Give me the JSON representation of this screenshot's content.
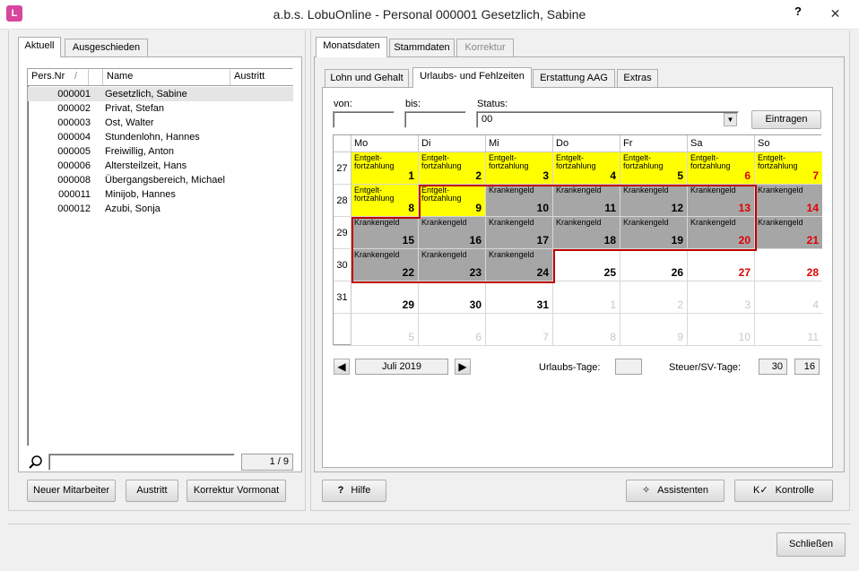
{
  "window": {
    "title": "a.b.s. LobuOnline - Personal 000001 Gesetzlich, Sabine",
    "help": "?",
    "close": "✕",
    "icon": "app-logo-icon"
  },
  "left_tabs": [
    "Aktuell",
    "Ausgeschieden"
  ],
  "list": {
    "columns": [
      "Pers.Nr",
      "Name",
      "Austritt"
    ],
    "sort_indicator": "/",
    "rows": [
      {
        "nr": "000001",
        "name": "Gesetzlich, Sabine"
      },
      {
        "nr": "000002",
        "name": "Privat, Stefan"
      },
      {
        "nr": "000003",
        "name": "Ost, Walter"
      },
      {
        "nr": "000004",
        "name": "Stundenlohn, Hannes"
      },
      {
        "nr": "000005",
        "name": "Freiwillig, Anton"
      },
      {
        "nr": "000006",
        "name": "Altersteilzeit, Hans"
      },
      {
        "nr": "000008",
        "name": "Übergangsbereich, Michael"
      },
      {
        "nr": "000011",
        "name": "Minijob, Hannes"
      },
      {
        "nr": "000012",
        "name": "Azubi, Sonja"
      }
    ],
    "search_value": "",
    "counter": "1 / 9"
  },
  "left_buttons": {
    "new_employee": "Neuer Mitarbeiter",
    "exit": "Austritt",
    "correction": "Korrektur Vormonat"
  },
  "top_tabs": [
    "Monatsdaten",
    "Stammdaten",
    "Korrektur"
  ],
  "sub_tabs": [
    "Lohn und Gehalt",
    "Urlaubs- und Fehlzeiten",
    "Erstattung AAG",
    "Extras"
  ],
  "form": {
    "from_label": "von:",
    "from_value": "",
    "to_label": "bis:",
    "to_value": "",
    "status_label": "Status:",
    "status_value": "00",
    "enter_button": "Eintragen"
  },
  "calendar": {
    "days": [
      "Mo",
      "Di",
      "Mi",
      "Do",
      "Fr",
      "Sa",
      "So"
    ],
    "weeks": [
      "27",
      "28",
      "29",
      "30",
      "31",
      ""
    ],
    "cells": [
      [
        "1",
        "2",
        "3",
        "4",
        "5",
        "6",
        "7"
      ],
      [
        "8",
        "9",
        "10",
        "11",
        "12",
        "13",
        "14"
      ],
      [
        "15",
        "16",
        "17",
        "18",
        "19",
        "20",
        "21"
      ],
      [
        "22",
        "23",
        "24",
        "25",
        "26",
        "27",
        "28"
      ],
      [
        "29",
        "30",
        "31",
        "1",
        "2",
        "3",
        "4"
      ],
      [
        "5",
        "6",
        "7",
        "8",
        "9",
        "10",
        "11"
      ]
    ],
    "label_entgelt_1": "Entgelt-",
    "label_entgelt_2": "fortzahlung",
    "label_krank": "Krankengeld"
  },
  "nav": {
    "prev": "◀",
    "month": "Juli 2019",
    "next": "▶"
  },
  "stats": {
    "vacation_label": "Urlaubs-Tage:",
    "vacation_value": "",
    "tax_label": "Steuer/SV-Tage:",
    "tax_value1": "30",
    "tax_value2": "16"
  },
  "bottom_buttons": {
    "help": "Hilfe",
    "assistant": "Assistenten",
    "control": "Kontrolle",
    "close": "Schließen"
  },
  "colors": {
    "continued_pay": "#ffff00",
    "sick_pay": "#a6a6a6",
    "weekend": "#e00000",
    "frame": "#c00000"
  }
}
